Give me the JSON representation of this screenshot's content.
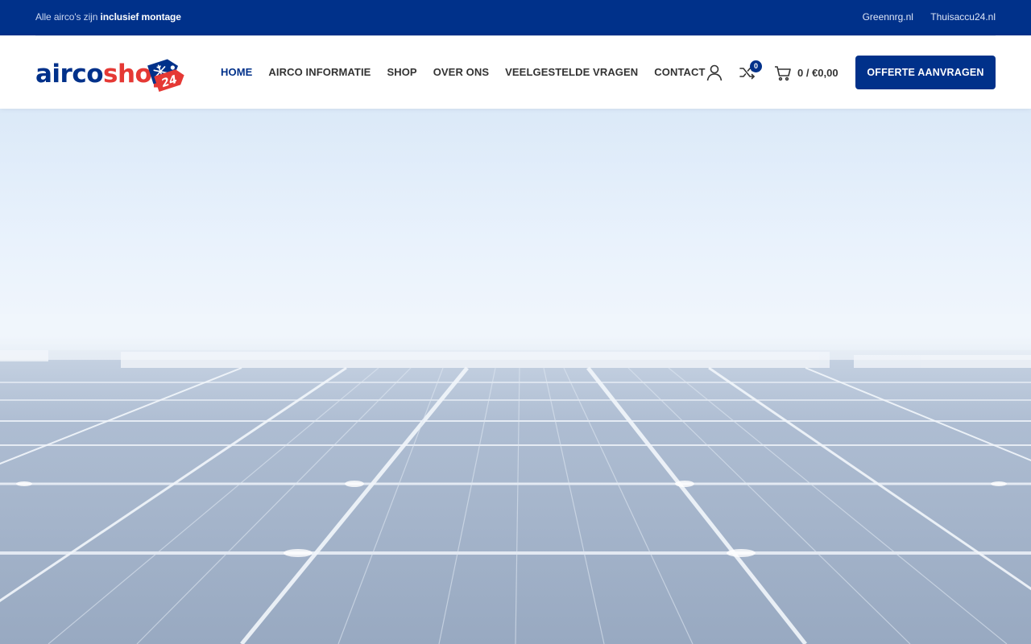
{
  "topbar": {
    "promo_prefix": "Alle airco's zijn",
    "promo_bold": "inclusief montage",
    "links": [
      "Greennrg.nl",
      "Thuisaccu24.nl"
    ]
  },
  "logo": {
    "part1": "airco",
    "part2": "shop",
    "badge": "24"
  },
  "nav": {
    "items": [
      "HOME",
      "AIRCO INFORMATIE",
      "SHOP",
      "OVER ONS",
      "VEELGESTELDE VRAGEN",
      "CONTACT"
    ],
    "active": "HOME"
  },
  "header_icons": {
    "account": "user-icon",
    "compare": "shuffle-icon",
    "compare_count": "0",
    "cart": "cart-icon",
    "cart_total": "0 / €0,00"
  },
  "cta": {
    "label": "OFFERTE AANVRAGEN"
  },
  "colors": {
    "brand_blue": "#00318a",
    "brand_red": "#e53935"
  }
}
